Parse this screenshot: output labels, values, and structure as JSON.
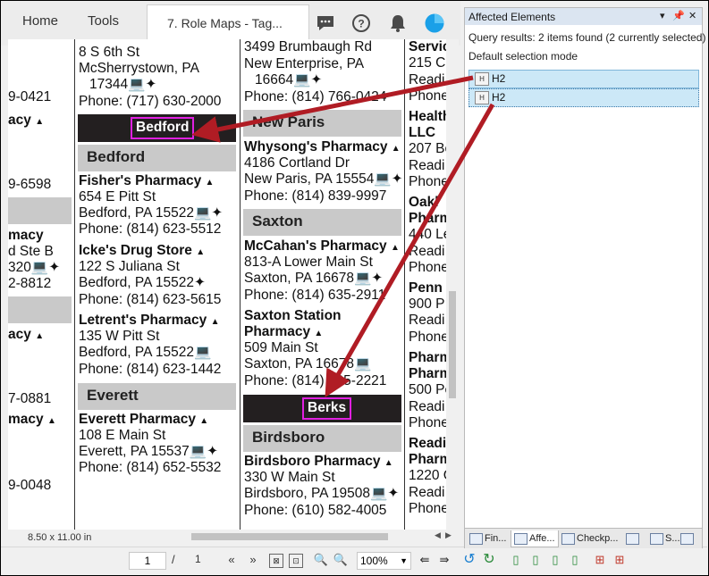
{
  "tabs": {
    "home": "Home",
    "tools": "Tools",
    "document": "7. Role Maps - Tag..."
  },
  "document": {
    "page_size": "8.50 x 11.00 in",
    "col0": {
      "l1": "9-0421",
      "l2": "acy",
      "l3": "9-6598",
      "l4": "macy",
      "l5": "d Ste B",
      "l6": "320",
      "l7": "2-8812",
      "l8": "acy",
      "l9": "7-0881",
      "l10": "macy",
      "l11": "9-0048"
    },
    "col1": {
      "l1": "8 S 6th St",
      "l2": "McSherrystown, PA",
      "l3": "17344",
      "l4": "Phone: (717) 630-2000",
      "bedford_tag": "Bedford",
      "bedford_heading": "Bedford",
      "fisher_name": "Fisher's Pharmacy",
      "fisher_addr": "654 E Pitt St",
      "fisher_city": "Bedford, PA 15522",
      "fisher_phone": "Phone: (814) 623-5512",
      "icke_name": "Icke's Drug Store",
      "icke_addr": "122 S Juliana St",
      "icke_city": "Bedford, PA 15522",
      "icke_phone": "Phone: (814) 623-5615",
      "letrent_name": "Letrent's Pharmacy",
      "letrent_addr": "135 W Pitt St",
      "letrent_city": "Bedford, PA 15522",
      "letrent_phone": "Phone: (814) 623-1442",
      "everett_heading": "Everett",
      "everett_name": "Everett Pharmacy",
      "everett_addr": "108 E Main St",
      "everett_city": "Everett, PA 15537",
      "everett_phone": "Phone: (814) 652-5532"
    },
    "col2": {
      "l1": "3499 Brumbaugh Rd",
      "l2": "New Enterprise, PA",
      "l3": "16664",
      "l4": "Phone: (814) 766-0424",
      "newparis_heading": "New Paris",
      "whysong_name": "Whysong's Pharmacy",
      "whysong_addr": "4186 Cortland Dr",
      "whysong_city": "New Paris, PA 15554",
      "whysong_phone": "Phone: (814) 839-9997",
      "saxton_heading": "Saxton",
      "mccahan_name": "McCahan's Pharmacy",
      "mccahan_addr": "813-A Lower Main St",
      "mccahan_city": "Saxton, PA 16678",
      "mccahan_phone": "Phone: (814) 635-2911",
      "saxstation_name1": "Saxton Station",
      "saxstation_name2": "Pharmacy",
      "saxstation_addr": "509 Main St",
      "saxstation_city": "Saxton, PA 16678",
      "saxstation_phone": "Phone: (814) 635-2221",
      "berks_tag": "Berks",
      "birdsboro_heading": "Birdsboro",
      "birdsboro_name": "Birdsboro Pharmacy",
      "birdsboro_addr": "330 W Main St",
      "birdsboro_city": "Birdsboro, PA 19508",
      "birdsboro_phone": "Phone: (610) 582-4005"
    },
    "col3": {
      "l1": "Servic",
      "l2": "215 C",
      "l3": "Readi",
      "l4": "Phone",
      "l5": "Health",
      "l6": "LLC",
      "l7": "207 Be",
      "l8": "Readi",
      "l9": "Phone",
      "l10": "Oakl",
      "l11": "Pharm",
      "l12": "440 Le",
      "l13": "Readi",
      "l14": "Phone",
      "l15": "Penn",
      "l16": "900 P",
      "l17": "Readi",
      "l18": "Phone",
      "l19": "Pharm",
      "l20": "Pharm",
      "l21": "500 Pe",
      "l22": "Readi",
      "l23": "Phone",
      "l24": "Readi",
      "l25": "Pharm",
      "l26": "1220 C",
      "l27": "Readi",
      "l28": "Phone"
    }
  },
  "toolbar": {
    "current_page": "1",
    "page_separator": "/",
    "page_count": "1",
    "zoom": "100%"
  },
  "panel": {
    "title": "Affected Elements",
    "query_results": "Query results: 2 items found (2 currently selected)",
    "selection_mode": "Default selection mode",
    "items": [
      {
        "label": "H2"
      },
      {
        "label": "H2"
      }
    ],
    "tabs": [
      {
        "label": "Fin..."
      },
      {
        "label": "Affe..."
      },
      {
        "label": "Checkp..."
      },
      {
        "label": ""
      },
      {
        "label": "S..."
      },
      {
        "label": ""
      }
    ]
  },
  "colors": {
    "heading_bar": "#c9c9c9",
    "black_bar": "#231f20",
    "tag_outline": "#e020e0",
    "arrow": "#b01c24",
    "selection": "#cce8f7"
  }
}
